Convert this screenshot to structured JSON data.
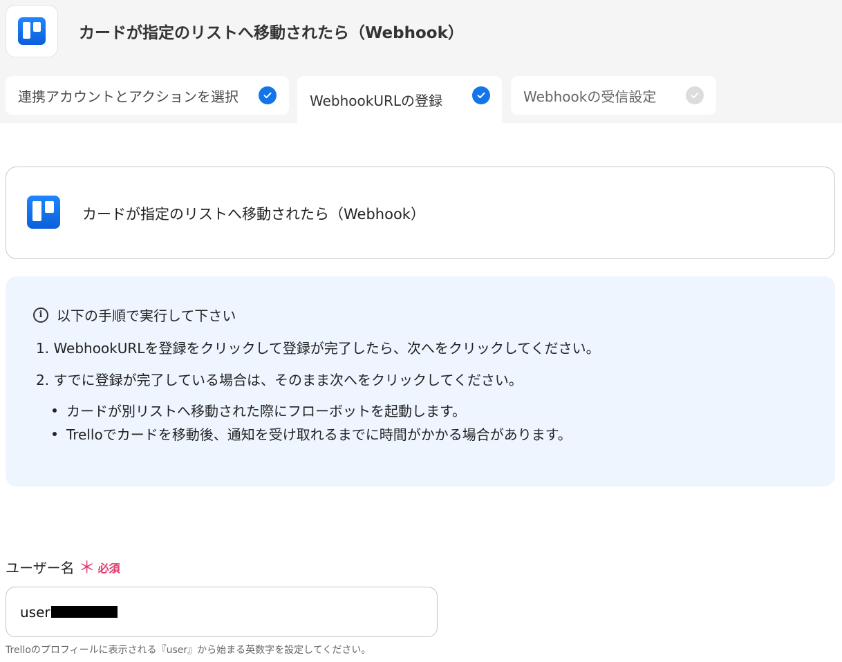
{
  "header": {
    "title": "カードが指定のリストへ移動されたら（Webhook）",
    "app_icon": "trello-logo-icon"
  },
  "tabs": [
    {
      "label": "連携アカウントとアクションを選択",
      "state": "completed"
    },
    {
      "label": "WebhookURLの登録",
      "state": "completed",
      "active": true
    },
    {
      "label": "Webhookの受信設定",
      "state": "pending"
    }
  ],
  "trigger_card": {
    "label": "カードが指定のリストへ移動されたら（Webhook）",
    "icon": "trello-logo-icon"
  },
  "info": {
    "heading": "以下の手順で実行して下さい",
    "steps": [
      "1. WebhookURLを登録をクリックして登録が完了したら、次へをクリックしてください。",
      "2. すでに登録が完了している場合は、そのまま次へをクリックしてください。"
    ],
    "notes": [
      "カードが別リストへ移動された際にフローボットを起動します。",
      "Trelloでカードを移動後、通知を受け取れるまでに時間がかかる場合があります。"
    ]
  },
  "username_field": {
    "label": "ユーザー名",
    "required_mark": "＊",
    "required_text": "必須",
    "value": "user",
    "help": "Trelloのプロフィールに表示される『user』から始まる英数字を設定してください。"
  },
  "colors": {
    "accent": "#1474e9",
    "required": "#e03a6b",
    "info_bg": "#eef5fe"
  }
}
